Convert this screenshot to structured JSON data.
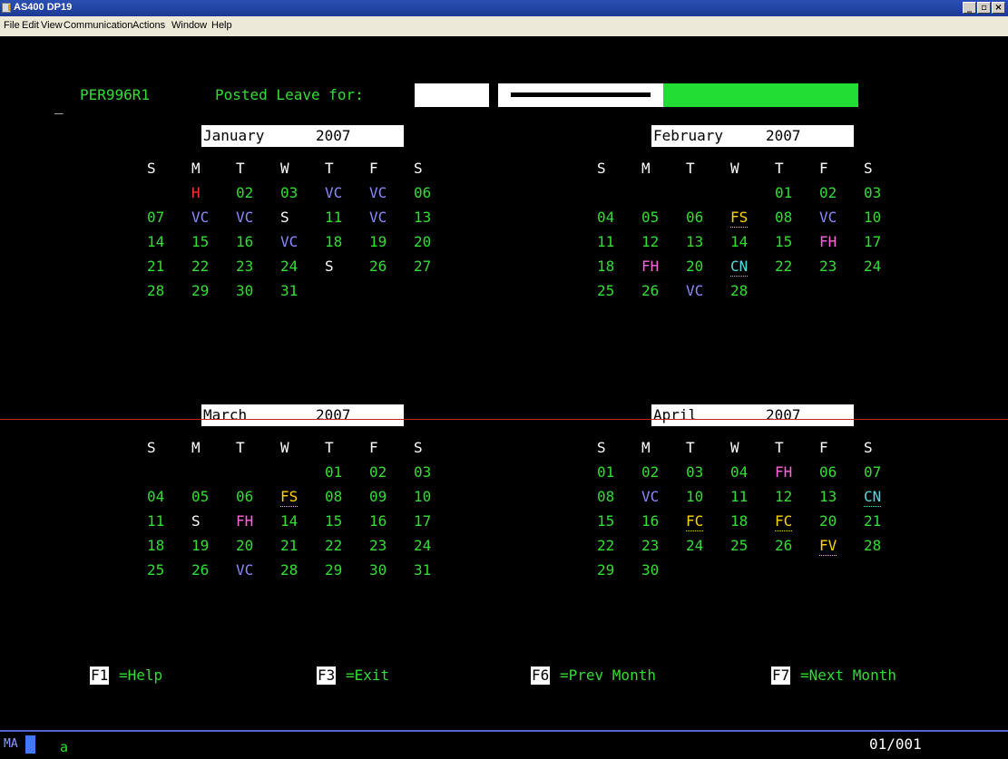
{
  "window": {
    "title": "AS400 DP19",
    "controls": [
      "_",
      "▫",
      "×"
    ]
  },
  "menu": [
    "File",
    "Edit",
    "View",
    "Communication",
    "Actions",
    "Window",
    "Help"
  ],
  "header": {
    "cursor": "_",
    "program": "PER996R1",
    "label": "Posted Leave for:"
  },
  "calendars": [
    {
      "month": "January",
      "year": "2007",
      "days": [
        "S",
        "M",
        "T",
        "W",
        "T",
        "F",
        "S"
      ],
      "weeks": [
        [
          null,
          {
            "t": "H",
            "c": "r"
          },
          {
            "t": "02",
            "c": "g"
          },
          {
            "t": "03",
            "c": "g"
          },
          {
            "t": "VC",
            "c": "v"
          },
          {
            "t": "VC",
            "c": "v"
          },
          {
            "t": "06",
            "c": "g"
          }
        ],
        [
          {
            "t": "07",
            "c": "g"
          },
          {
            "t": "VC",
            "c": "v"
          },
          {
            "t": "VC",
            "c": "v"
          },
          {
            "t": "S",
            "c": "w"
          },
          {
            "t": "11",
            "c": "g"
          },
          {
            "t": "VC",
            "c": "v"
          },
          {
            "t": "13",
            "c": "g"
          }
        ],
        [
          {
            "t": "14",
            "c": "g"
          },
          {
            "t": "15",
            "c": "g"
          },
          {
            "t": "16",
            "c": "g"
          },
          {
            "t": "VC",
            "c": "v"
          },
          {
            "t": "18",
            "c": "g"
          },
          {
            "t": "19",
            "c": "g"
          },
          {
            "t": "20",
            "c": "g"
          }
        ],
        [
          {
            "t": "21",
            "c": "g"
          },
          {
            "t": "22",
            "c": "g"
          },
          {
            "t": "23",
            "c": "g"
          },
          {
            "t": "24",
            "c": "g"
          },
          {
            "t": "S",
            "c": "w"
          },
          {
            "t": "26",
            "c": "g"
          },
          {
            "t": "27",
            "c": "g"
          }
        ],
        [
          {
            "t": "28",
            "c": "g"
          },
          {
            "t": "29",
            "c": "g"
          },
          {
            "t": "30",
            "c": "g"
          },
          {
            "t": "31",
            "c": "g"
          },
          null,
          null,
          null
        ]
      ]
    },
    {
      "month": "February",
      "year": "2007",
      "days": [
        "S",
        "M",
        "T",
        "W",
        "T",
        "F",
        "S"
      ],
      "weeks": [
        [
          null,
          null,
          null,
          null,
          {
            "t": "01",
            "c": "g"
          },
          {
            "t": "02",
            "c": "g"
          },
          {
            "t": "03",
            "c": "g"
          }
        ],
        [
          {
            "t": "04",
            "c": "g"
          },
          {
            "t": "05",
            "c": "g"
          },
          {
            "t": "06",
            "c": "g"
          },
          {
            "t": "FS",
            "c": "y",
            "u": true
          },
          {
            "t": "08",
            "c": "g"
          },
          {
            "t": "VC",
            "c": "v"
          },
          {
            "t": "10",
            "c": "g"
          }
        ],
        [
          {
            "t": "11",
            "c": "g"
          },
          {
            "t": "12",
            "c": "g"
          },
          {
            "t": "13",
            "c": "g"
          },
          {
            "t": "14",
            "c": "g"
          },
          {
            "t": "15",
            "c": "g"
          },
          {
            "t": "FH",
            "c": "p"
          },
          {
            "t": "17",
            "c": "g"
          }
        ],
        [
          {
            "t": "18",
            "c": "g"
          },
          {
            "t": "FH",
            "c": "p"
          },
          {
            "t": "20",
            "c": "g"
          },
          {
            "t": "CN",
            "c": "c",
            "u": true
          },
          {
            "t": "22",
            "c": "g"
          },
          {
            "t": "23",
            "c": "g"
          },
          {
            "t": "24",
            "c": "g"
          }
        ],
        [
          {
            "t": "25",
            "c": "g"
          },
          {
            "t": "26",
            "c": "g"
          },
          {
            "t": "VC",
            "c": "v"
          },
          {
            "t": "28",
            "c": "g"
          },
          null,
          null,
          null
        ]
      ]
    },
    {
      "month": "March",
      "year": "2007",
      "days": [
        "S",
        "M",
        "T",
        "W",
        "T",
        "F",
        "S"
      ],
      "weeks": [
        [
          null,
          null,
          null,
          null,
          {
            "t": "01",
            "c": "g"
          },
          {
            "t": "02",
            "c": "g"
          },
          {
            "t": "03",
            "c": "g"
          }
        ],
        [
          {
            "t": "04",
            "c": "g"
          },
          {
            "t": "05",
            "c": "g"
          },
          {
            "t": "06",
            "c": "g"
          },
          {
            "t": "FS",
            "c": "y",
            "u": true
          },
          {
            "t": "08",
            "c": "g"
          },
          {
            "t": "09",
            "c": "g"
          },
          {
            "t": "10",
            "c": "g"
          }
        ],
        [
          {
            "t": "11",
            "c": "g"
          },
          {
            "t": "S",
            "c": "w"
          },
          {
            "t": "FH",
            "c": "p"
          },
          {
            "t": "14",
            "c": "g"
          },
          {
            "t": "15",
            "c": "g"
          },
          {
            "t": "16",
            "c": "g"
          },
          {
            "t": "17",
            "c": "g"
          }
        ],
        [
          {
            "t": "18",
            "c": "g"
          },
          {
            "t": "19",
            "c": "g"
          },
          {
            "t": "20",
            "c": "g"
          },
          {
            "t": "21",
            "c": "g"
          },
          {
            "t": "22",
            "c": "g"
          },
          {
            "t": "23",
            "c": "g"
          },
          {
            "t": "24",
            "c": "g"
          }
        ],
        [
          {
            "t": "25",
            "c": "g"
          },
          {
            "t": "26",
            "c": "g"
          },
          {
            "t": "VC",
            "c": "v"
          },
          {
            "t": "28",
            "c": "g"
          },
          {
            "t": "29",
            "c": "g"
          },
          {
            "t": "30",
            "c": "g"
          },
          {
            "t": "31",
            "c": "g"
          }
        ]
      ]
    },
    {
      "month": "April",
      "year": "2007",
      "days": [
        "S",
        "M",
        "T",
        "W",
        "T",
        "F",
        "S"
      ],
      "weeks": [
        [
          {
            "t": "01",
            "c": "g"
          },
          {
            "t": "02",
            "c": "g"
          },
          {
            "t": "03",
            "c": "g"
          },
          {
            "t": "04",
            "c": "g"
          },
          {
            "t": "FH",
            "c": "p"
          },
          {
            "t": "06",
            "c": "g"
          },
          {
            "t": "07",
            "c": "g"
          }
        ],
        [
          {
            "t": "08",
            "c": "g"
          },
          {
            "t": "VC",
            "c": "v"
          },
          {
            "t": "10",
            "c": "g"
          },
          {
            "t": "11",
            "c": "g"
          },
          {
            "t": "12",
            "c": "g"
          },
          {
            "t": "13",
            "c": "g"
          },
          {
            "t": "CN",
            "c": "c",
            "u": true
          }
        ],
        [
          {
            "t": "15",
            "c": "g"
          },
          {
            "t": "16",
            "c": "g"
          },
          {
            "t": "FC",
            "c": "y",
            "u": true
          },
          {
            "t": "18",
            "c": "g"
          },
          {
            "t": "FC",
            "c": "y",
            "u": true
          },
          {
            "t": "20",
            "c": "g"
          },
          {
            "t": "21",
            "c": "g"
          }
        ],
        [
          {
            "t": "22",
            "c": "g"
          },
          {
            "t": "23",
            "c": "g"
          },
          {
            "t": "24",
            "c": "g"
          },
          {
            "t": "25",
            "c": "g"
          },
          {
            "t": "26",
            "c": "g"
          },
          {
            "t": "FV",
            "c": "y",
            "u": true
          },
          {
            "t": "28",
            "c": "g"
          }
        ],
        [
          {
            "t": "29",
            "c": "g"
          },
          {
            "t": "30",
            "c": "g"
          },
          null,
          null,
          null,
          null,
          null
        ]
      ]
    }
  ],
  "fkeys": [
    {
      "key": "F1",
      "label": "=Help"
    },
    {
      "key": "F3",
      "label": "=Exit"
    },
    {
      "key": "F6",
      "label": "=Prev Month"
    },
    {
      "key": "F7",
      "label": "=Next Month"
    }
  ],
  "status": {
    "mode": "MA",
    "input": "a",
    "position": "01/001"
  },
  "colors": {
    "green": "#33dd33",
    "white": "#ffffff",
    "blue": "#8a8aff",
    "red": "#ff3030",
    "yellow": "#ffd400",
    "pink": "#ff66dd",
    "cyan": "#55dddd",
    "field_green": "#22dd33"
  }
}
